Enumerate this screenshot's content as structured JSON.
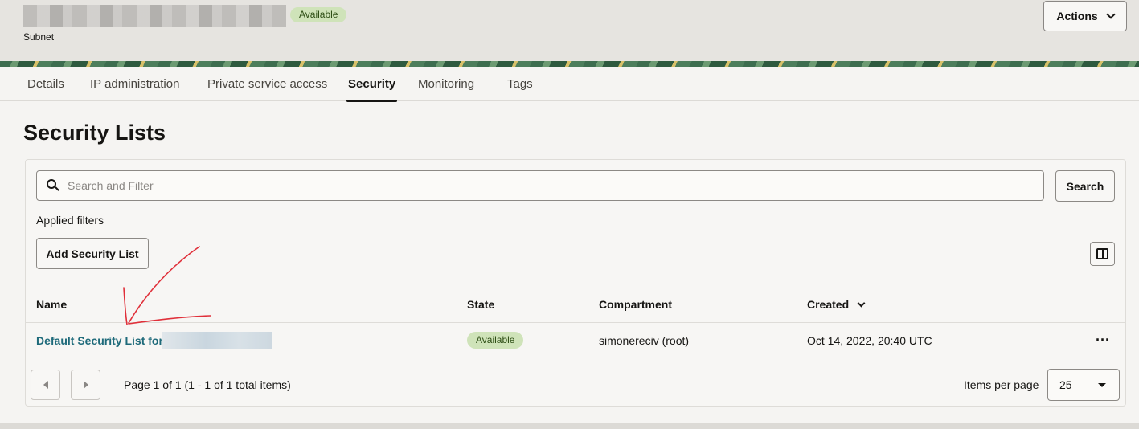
{
  "header": {
    "resource_type": "Subnet",
    "status": "Available",
    "actions_label": "Actions"
  },
  "tabs": [
    {
      "label": "Details"
    },
    {
      "label": "IP administration"
    },
    {
      "label": "Private service access"
    },
    {
      "label": "Security",
      "active": true
    },
    {
      "label": "Monitoring"
    },
    {
      "label": "Tags"
    }
  ],
  "page": {
    "title": "Security Lists"
  },
  "toolbar": {
    "search_placeholder": "Search and Filter",
    "search_button": "Search",
    "applied_filters": "Applied filters",
    "add_button": "Add Security List"
  },
  "table": {
    "columns": [
      "Name",
      "State",
      "Compartment",
      "Created"
    ],
    "rows": [
      {
        "name": "Default Security List for",
        "state": "Available",
        "compartment": "simonereciv (root)",
        "created": "Oct 14, 2022, 20:40 UTC",
        "more": "···"
      }
    ]
  },
  "pagination": {
    "page_info": "Page 1 of 1 (1 - 1 of 1 total items)",
    "items_per_page_label": "Items per page",
    "items_per_page": "25"
  },
  "colors": {
    "link": "#1e6a7a",
    "badge_bg": "#cfe3b9",
    "annotation_arrow": "#e0303a"
  }
}
